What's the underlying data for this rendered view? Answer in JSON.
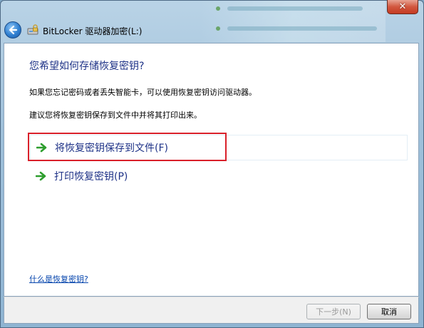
{
  "window": {
    "title": "BitLocker 驱动器加密(L:)",
    "close_symbol": "✕"
  },
  "content": {
    "heading": "您希望如何存储恢复密钥?",
    "description_1": "如果您忘记密码或者丢失智能卡，可以使用恢复密钥访问驱动器。",
    "description_2": "建议您将恢复密钥保存到文件中并将其打印出来。",
    "options": [
      {
        "label": "将恢复密钥保存到文件(F)",
        "icon": "green-arrow-icon"
      },
      {
        "label": "打印恢复密钥(P)",
        "icon": "green-arrow-icon"
      }
    ],
    "help_link": "什么是恢复密钥?"
  },
  "buttons": {
    "next_label": "下一步(N)",
    "cancel_label": "取消"
  },
  "colors": {
    "heading": "#1e3287",
    "highlight": "#d9202a",
    "arrow": "#2e9e2e",
    "link": "#0645ad"
  }
}
